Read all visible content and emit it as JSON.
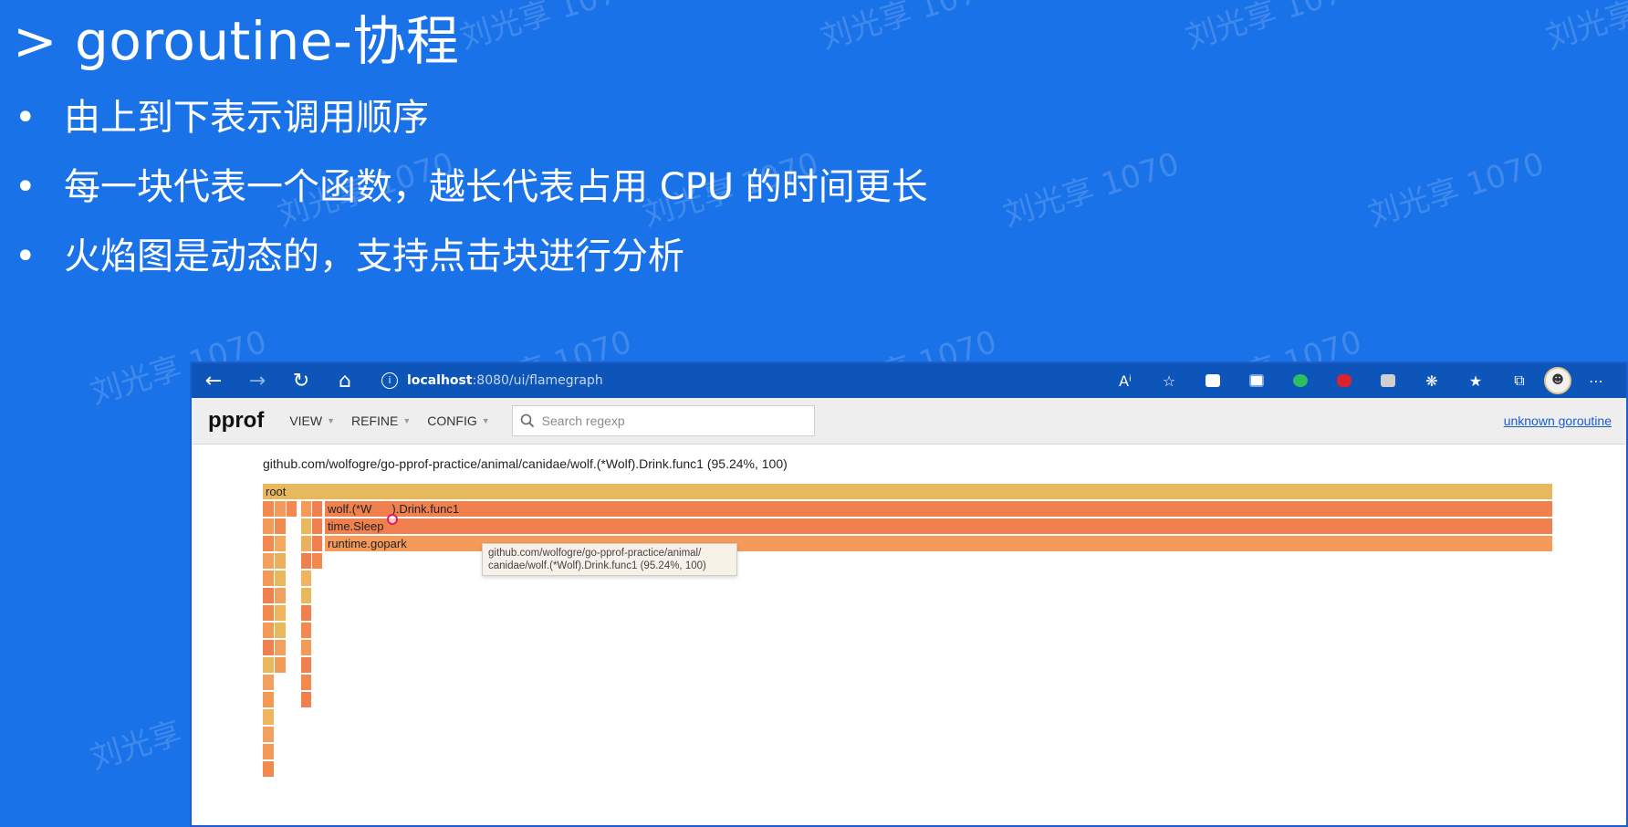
{
  "slide": {
    "title": "> goroutine-协程",
    "bullets": [
      "由上到下表示调用顺序",
      "每一块代表一个函数，越长代表占用 CPU 的时间更长",
      "火焰图是动态的，支持点击块进行分析"
    ],
    "bullet_symbol": "•",
    "watermark": "刘光享 1070"
  },
  "browser": {
    "url_host": "localhost",
    "url_rest": ":8080/ui/flamegraph",
    "nav_icons": [
      "back-icon",
      "forward-icon",
      "reload-icon",
      "home-icon"
    ],
    "toolbar_icons": [
      "read-aloud-icon",
      "add-favorite-icon",
      "extension-icon",
      "extension-icon",
      "evernote-icon",
      "extension-icon",
      "extension-icon",
      "extension-icon",
      "favorites-icon",
      "collections-icon",
      "profile-icon",
      "more-icon"
    ],
    "ext_colors": [
      "#ffffff",
      "#ffffff",
      "#2dbe60",
      "#d9232e",
      "#cfcfcf"
    ]
  },
  "pprof": {
    "logo": "pprof",
    "menu": [
      "VIEW",
      "REFINE",
      "CONFIG"
    ],
    "search_placeholder": "Search regexp",
    "right_link": "unknown goroutine",
    "caption": "github.com/wolfogre/go-pprof-practice/animal/canidae/wolf.(*Wolf).Drink.func1 (95.24%, 100)"
  },
  "flamegraph": {
    "frames": [
      {
        "label": "root",
        "color": "#e8b95c"
      },
      {
        "label": "wolf.(*W",
        "label_after_cursor": ").Drink.func1",
        "color": "#f0804e"
      },
      {
        "label": "time.Sleep",
        "color": "#f0804e"
      },
      {
        "label": "runtime.gopark",
        "color": "#f59a58"
      }
    ],
    "tooltip_lines": [
      "github.com/wolfogre/go-pprof-practice/animal/",
      "canidae/wolf.(*Wolf).Drink.func1 (95.24%, 100)"
    ]
  }
}
